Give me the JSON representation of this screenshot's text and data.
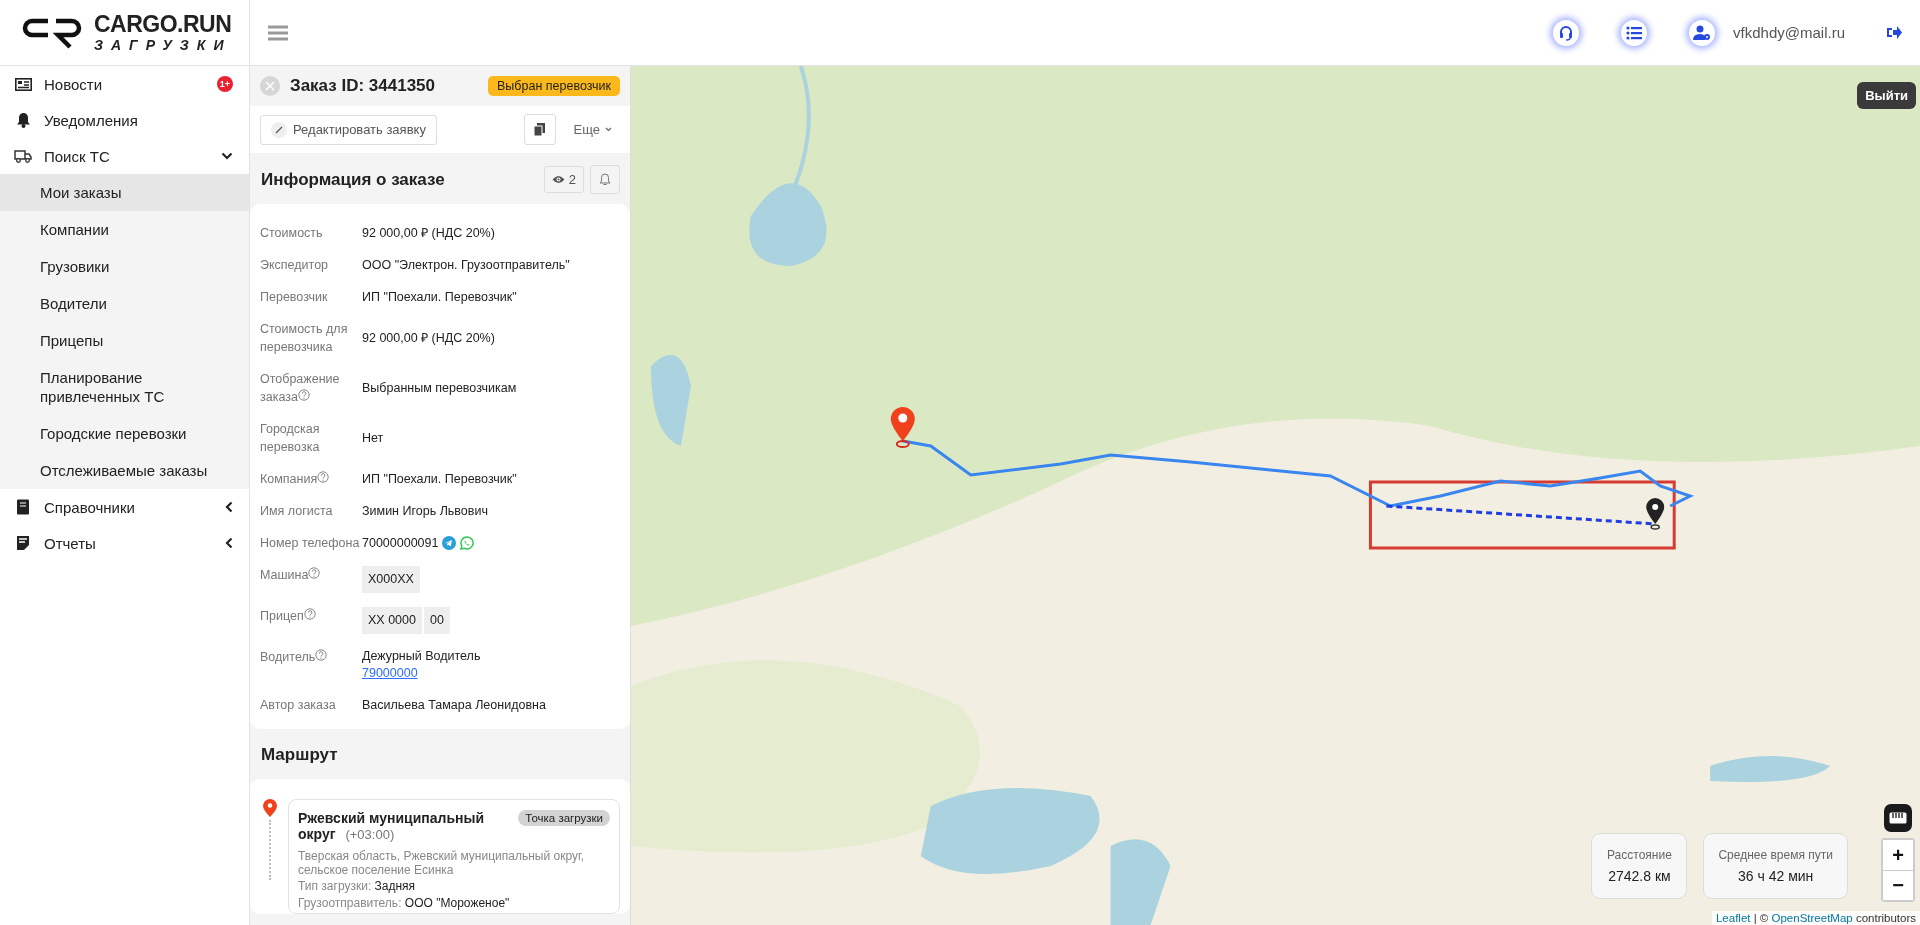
{
  "logo": {
    "title": "CARGO.RUN",
    "subtitle": "ЗАГРУЗКИ"
  },
  "sidebar": {
    "items": [
      {
        "label": "Новости",
        "kind": "link",
        "badge": "1+"
      },
      {
        "label": "Уведомления",
        "kind": "link"
      },
      {
        "label": "Поиск ТС",
        "kind": "group",
        "expanded": true,
        "children": [
          {
            "label": "Мои заказы",
            "selected": true
          },
          {
            "label": "Компании",
            "selected": false
          },
          {
            "label": "Грузовики",
            "selected": false
          },
          {
            "label": "Водители",
            "selected": false
          },
          {
            "label": "Прицепы",
            "selected": false
          },
          {
            "label": "Планирование привлеченных ТС",
            "selected": false
          },
          {
            "label": "Городские перевозки",
            "selected": false
          },
          {
            "label": "Отслеживаемые заказы",
            "selected": false
          }
        ]
      },
      {
        "label": "Справочники",
        "kind": "group",
        "expanded": false
      },
      {
        "label": "Отчеты",
        "kind": "group",
        "expanded": false
      }
    ]
  },
  "topbar": {
    "user_email": "vfkdhdy@mail.ru",
    "logout_tooltip": "Выйти"
  },
  "order": {
    "title": "Заказ ID: 3441350",
    "status": "Выбран перевозчик",
    "edit_button": "Редактировать заявку",
    "more_button": "Еще",
    "info_title": "Информация о заказе",
    "views": "2",
    "fields": [
      {
        "label": "Стоимость",
        "help": false,
        "kind": "text",
        "value": "92 000,00 ₽ (НДС 20%)"
      },
      {
        "label": "Экспедитор",
        "help": false,
        "kind": "text",
        "value": "ООО \"Электрон. Грузоотправитель\""
      },
      {
        "label": "Перевозчик",
        "help": false,
        "kind": "text",
        "value": "ИП \"Поехали. Перевозчик\""
      },
      {
        "label": "Стоимость для перевозчика",
        "help": false,
        "kind": "text",
        "value": "92 000,00 ₽ (НДС 20%)"
      },
      {
        "label": "Отображение заказа",
        "help": true,
        "kind": "text",
        "value": "Выбранным перевозчикам"
      },
      {
        "label": "Городская перевозка",
        "help": false,
        "kind": "text",
        "value": "Нет"
      },
      {
        "label": "Компания",
        "help": true,
        "kind": "text",
        "value": "ИП \"Поехали. Перевозчик\""
      },
      {
        "label": "Имя логиста",
        "help": false,
        "kind": "text",
        "value": "Зимин Игорь Львович"
      },
      {
        "label": "Номер телефона",
        "help": false,
        "kind": "phone",
        "value": "70000000091"
      },
      {
        "label": "Машина",
        "help": true,
        "kind": "plate",
        "plates": [
          "Х000ХХ"
        ]
      },
      {
        "label": "Прицеп",
        "help": true,
        "kind": "plate",
        "plates": [
          "ХХ 0000",
          "00"
        ]
      },
      {
        "label": "Водитель",
        "help": true,
        "kind": "driver",
        "value": "Дежурный Водитель",
        "link": "79000000"
      },
      {
        "label": "Автор заказа",
        "help": false,
        "kind": "text",
        "value": "Васильева Тамара Леонидовна"
      }
    ]
  },
  "route": {
    "title": "Маршрут",
    "points": [
      {
        "name": "Ржевский муниципальный округ",
        "timezone": "(+03:00)",
        "tag": "Точка загрузки",
        "address": "Тверская область, Ржевский муниципальный округ, сельское поселение Есинка",
        "details": [
          {
            "label": "Тип загрузки:",
            "value": "Задняя"
          },
          {
            "label": "Грузоотправитель:",
            "value": "ООО \"Мороженое\""
          }
        ]
      }
    ]
  },
  "map": {
    "stats": [
      {
        "label": "Расстояние",
        "value": "2742.8 км"
      },
      {
        "label": "Среднее время пути",
        "value": "36 ч 42 мин"
      }
    ],
    "zoom_in": "+",
    "zoom_out": "−",
    "attribution": [
      {
        "kind": "link",
        "text": "Leaflet"
      },
      {
        "kind": "text",
        "text": " | © "
      },
      {
        "kind": "link",
        "text": "OpenStreetMap"
      },
      {
        "kind": "text",
        "text": " contributors"
      }
    ]
  }
}
